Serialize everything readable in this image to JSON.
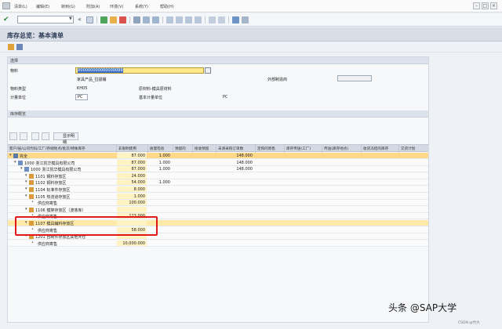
{
  "menu": {
    "items": [
      "清单(L)",
      "编辑(E)",
      "转到(G)",
      "附加(A)",
      "环境(V)",
      "系统(Y)",
      "帮助(H)"
    ]
  },
  "window": {
    "title": "库存总览：基本清单"
  },
  "selection": {
    "group_title": "选择",
    "material_label": "物料",
    "material_value": "X00000000000000099",
    "material_desc": "家具产品_拉拔桶",
    "ext_manufacturer_label": "外部制造商",
    "material_type_label": "物料类型",
    "material_type_value": "KH05",
    "material_type_desc": "原材料-模具原材料",
    "unit_label": "计量单位",
    "unit_value": "PC",
    "base_unit_label": "基本计量单位",
    "base_unit_value": "PC"
  },
  "overview": {
    "group_title": "库存概览",
    "detail_button": "显示明细",
    "columns": [
      "客户/层/公司代码/工厂/存储地点/批次/特殊库存",
      "非限制使用",
      "质量检验",
      "预留的",
      "接收预留",
      "未清采购订单数",
      "定购的寄售",
      "库存传送(工厂)",
      "传送(库存地点)",
      "收货冻结的库存",
      "交货计划"
    ],
    "rows": [
      {
        "label": "完全",
        "unrestricted": "87.000",
        "quality": "1.000",
        "open_po": "148.000"
      },
      {
        "label": "1000 浙江凯华模具有限公司",
        "unrestricted": "87.000",
        "quality": "1.000",
        "open_po": "148.000"
      },
      {
        "label": "1000 浙江凯华模具有限公司",
        "unrestricted": "87.000",
        "quality": "1.000",
        "open_po": "148.000"
      },
      {
        "label": "1101 钢料存放区",
        "unrestricted": "24.000",
        "quality": "",
        "open_po": ""
      },
      {
        "label": "1102 铜料存放区",
        "unrestricted": "54.000",
        "quality": "1.000",
        "open_po": ""
      },
      {
        "label": "1104 标准件存放区",
        "unrestricted": "8.000",
        "quality": "",
        "open_po": ""
      },
      {
        "label": "1105 热流道存放区",
        "unrestricted": "1.000",
        "quality": "",
        "open_po": ""
      },
      {
        "label": "供应商寄售",
        "unrestricted": "100.000",
        "quality": "",
        "open_po": ""
      },
      {
        "label": "1106 模架存放区（波菲库）",
        "unrestricted": "",
        "quality": "",
        "open_po": ""
      },
      {
        "label": "供应商寄售",
        "unrestricted": "123.000",
        "quality": "",
        "open_po": ""
      },
      {
        "label": "1107 模具辅料存放区",
        "unrestricted": "",
        "quality": "",
        "open_po": ""
      },
      {
        "label": "供应商寄售",
        "unrestricted": "58.000",
        "quality": "",
        "open_po": ""
      },
      {
        "label": "1201 自制件存放区其他大仓",
        "unrestricted": "",
        "quality": "",
        "open_po": ""
      },
      {
        "label": "供应商寄售",
        "unrestricted": "10,000.000",
        "quality": "",
        "open_po": ""
      }
    ]
  },
  "watermark": {
    "text": "头条 @SAP大学",
    "sub": "CSDN @竹大"
  },
  "colors": {
    "total_row": "#ffd98a",
    "highlight_box": "#e01818",
    "title": "#2b3a55"
  }
}
